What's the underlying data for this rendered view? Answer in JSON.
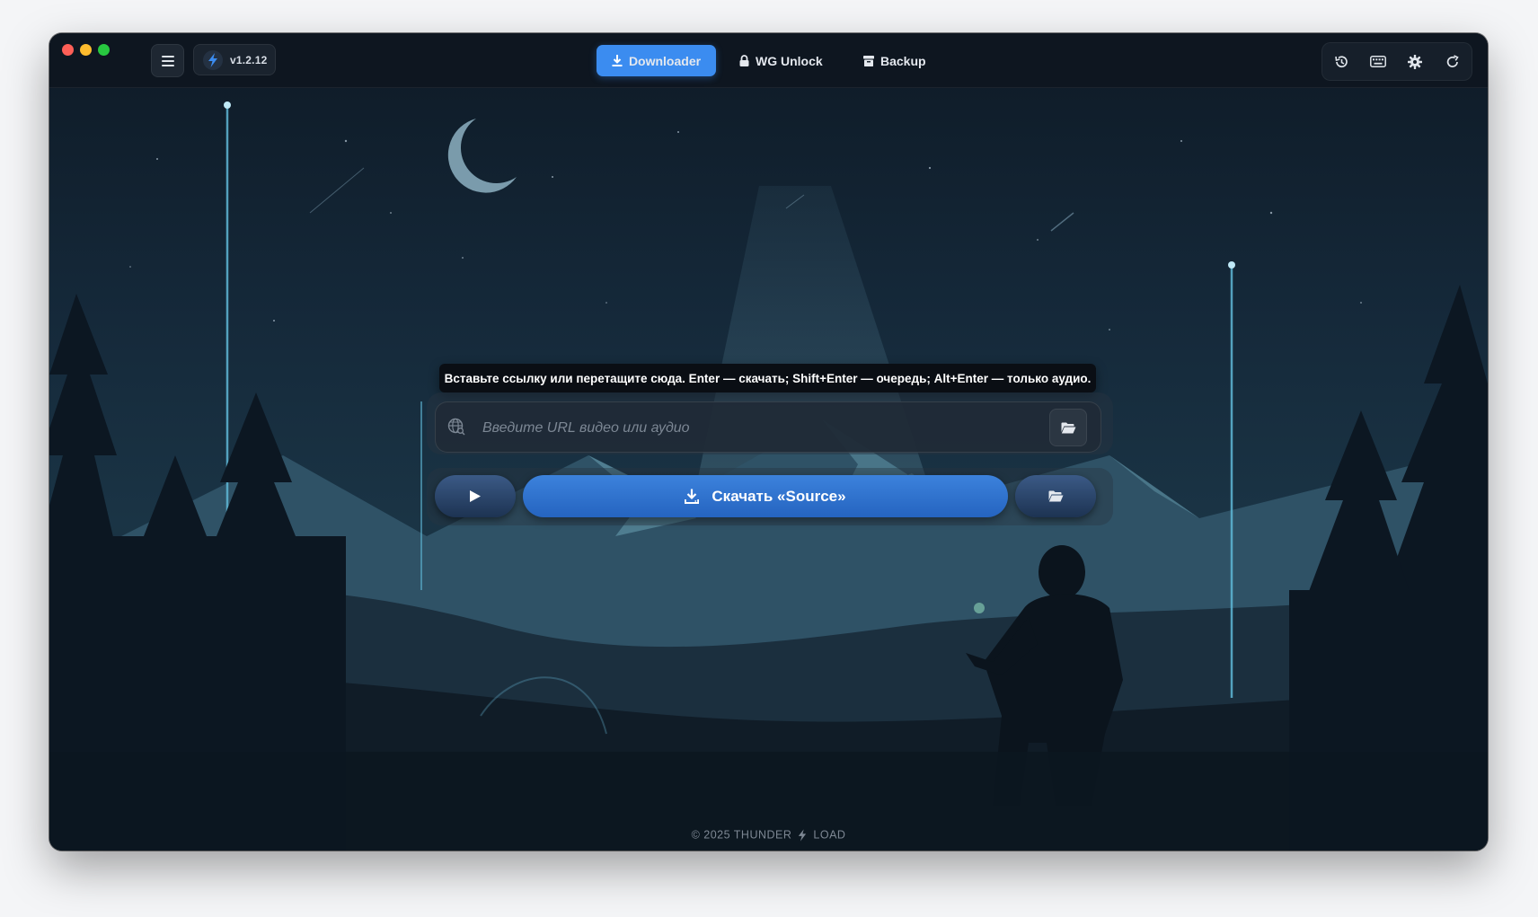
{
  "app": {
    "version": "v1.2.12"
  },
  "nav": {
    "tabs": [
      {
        "label": "Downloader",
        "icon": "download-icon",
        "active": true
      },
      {
        "label": "WG Unlock",
        "icon": "lock-icon",
        "active": false
      },
      {
        "label": "Backup",
        "icon": "archive-icon",
        "active": false
      }
    ]
  },
  "toolbar": {
    "icons": [
      "history-icon",
      "keyboard-icon",
      "gear-icon",
      "refresh-icon"
    ]
  },
  "main": {
    "tooltip": "Вставьте ссылку или перетащите сюда. Enter — скачать; Shift+Enter — очередь; Alt+Enter — только аудио.",
    "url_placeholder": "Введите URL видео или аудио",
    "url_value": "",
    "download_label": "Скачать «Source»"
  },
  "footer": {
    "copyright_left": "© 2025 THUNDER",
    "copyright_right": "LOAD"
  },
  "colors": {
    "accent": "#3b8cf0",
    "download_button": "#2f72d0",
    "titlebar": "#0e1620"
  }
}
